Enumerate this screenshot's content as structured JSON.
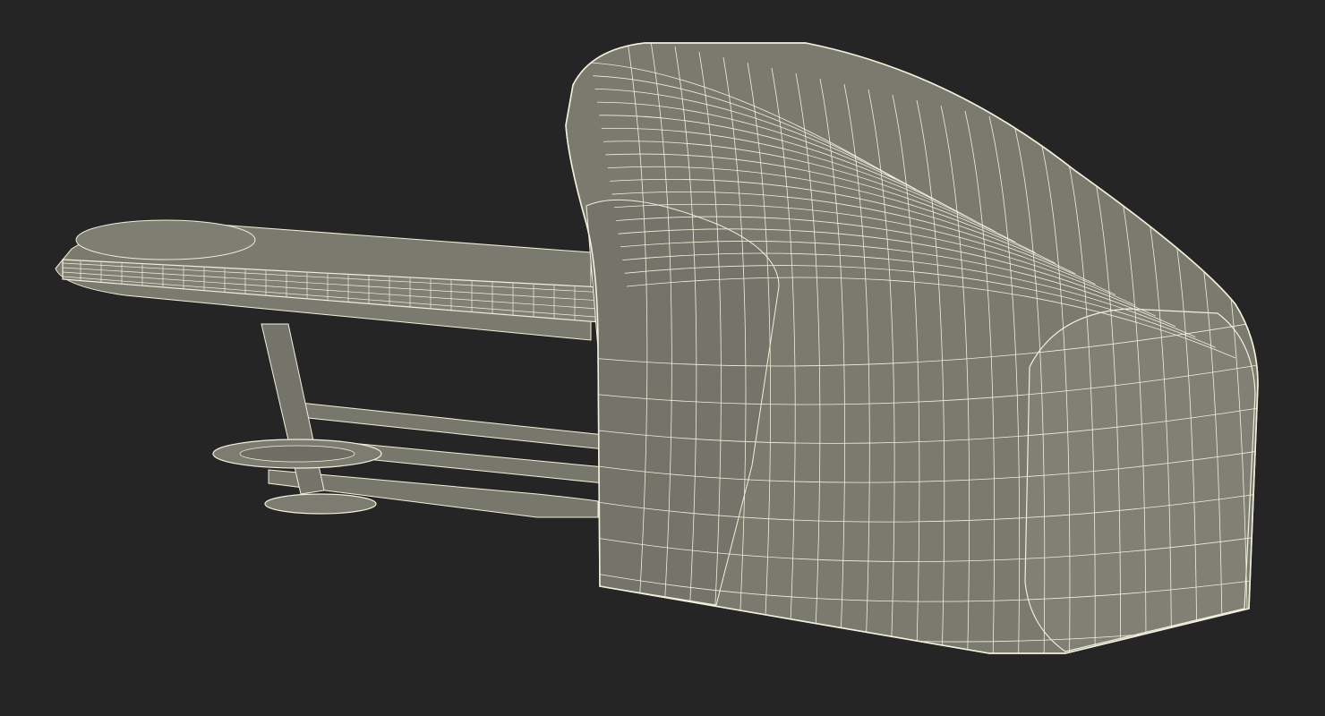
{
  "scene": {
    "subject": "wireframe-3d-model",
    "colors": {
      "background": "#252525",
      "surface": "#7a7a6e",
      "surface_dark": "#6b6b61",
      "surface_light": "#85857a",
      "wire": "#f2f0dc",
      "outline": "#4a4a44"
    }
  }
}
